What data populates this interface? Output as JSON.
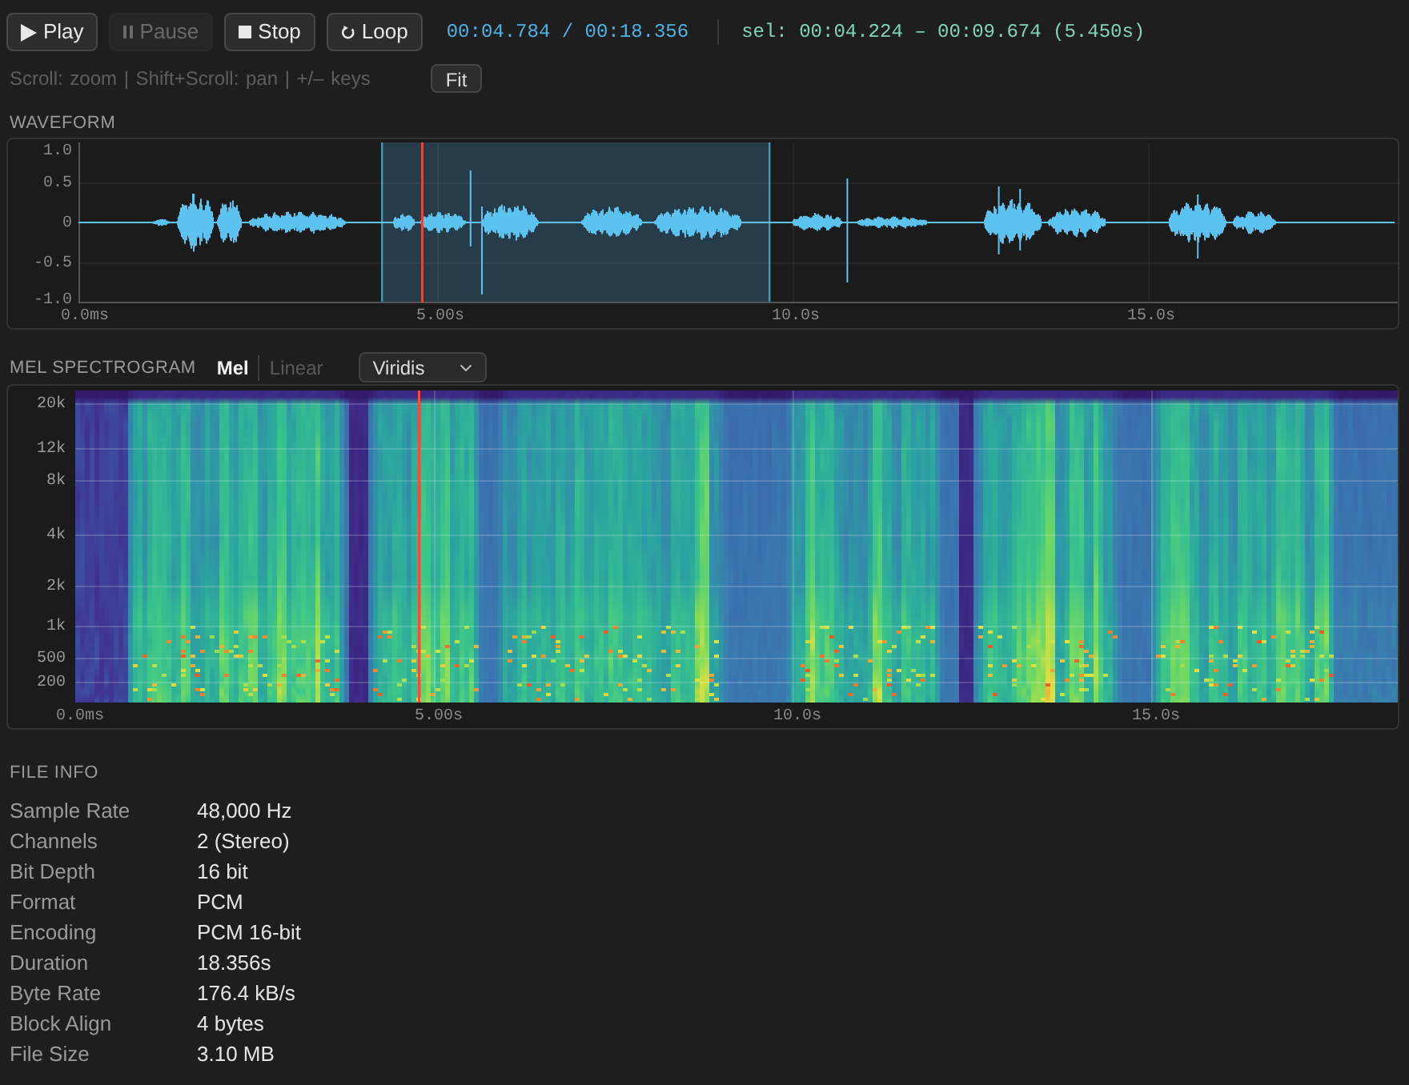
{
  "toolbar": {
    "buttons": [
      {
        "kind": "play",
        "label": "Play",
        "disabled": false
      },
      {
        "kind": "pause",
        "label": "Pause",
        "disabled": true
      },
      {
        "kind": "stop",
        "label": "Stop",
        "disabled": false
      },
      {
        "kind": "loop",
        "label": "Loop",
        "disabled": false
      }
    ],
    "time_readout": "00:04.784 / 00:18.356",
    "selection_readout": "sel: 00:04.224 – 00:09.674 (5.450s)"
  },
  "hint_bar": {
    "hint": "Scroll: zoom | Shift+Scroll: pan | +/– keys",
    "fit_button": "Fit"
  },
  "waveform": {
    "title": "WAVEFORM",
    "y_labels": [
      "1.0",
      "0.5",
      "0",
      "-0.5",
      "-1.0"
    ],
    "x_labels": [
      "0.0ms",
      "5.00s",
      "10.0s",
      "15.0s"
    ]
  },
  "spectrogram": {
    "title": "MEL SPECTROGRAM",
    "scale_tabs": [
      {
        "label": "Mel",
        "selected": true
      },
      {
        "label": "Linear",
        "selected": false
      }
    ],
    "colormap_select": {
      "value": "Viridis"
    },
    "y_labels": [
      "20k",
      "12k",
      "8k",
      "4k",
      "2k",
      "1k",
      "500",
      "200"
    ],
    "x_labels": [
      "0.0ms",
      "5.00s",
      "10.0s",
      "15.0s"
    ]
  },
  "file_info": {
    "title": "FILE INFO",
    "rows": [
      {
        "label": "Sample Rate",
        "value": "48,000 Hz"
      },
      {
        "label": "Channels",
        "value": "2 (Stereo)"
      },
      {
        "label": "Bit Depth",
        "value": "16 bit"
      },
      {
        "label": "Format",
        "value": "PCM"
      },
      {
        "label": "Encoding",
        "value": "PCM 16-bit"
      },
      {
        "label": "Duration",
        "value": "18.356s"
      },
      {
        "label": "Byte Rate",
        "value": "176.4 kB/s"
      },
      {
        "label": "Block Align",
        "value": "4 bytes"
      },
      {
        "label": "File Size",
        "value": "3.10 MB"
      }
    ]
  }
}
